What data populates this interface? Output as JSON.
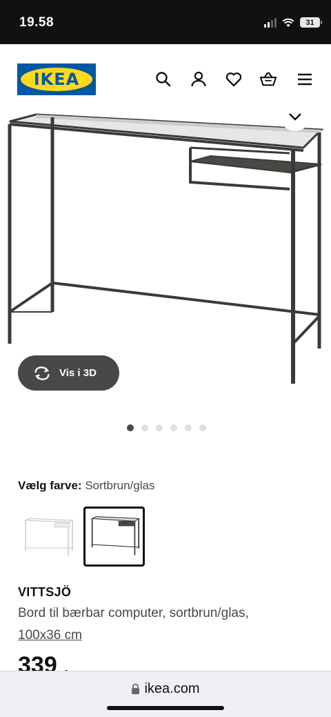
{
  "status_bar": {
    "time": "19.58",
    "battery": "31"
  },
  "header": {
    "logo_text": "IKEA",
    "icons": [
      "search-icon",
      "user-icon",
      "heart-icon",
      "basket-icon",
      "menu-icon"
    ]
  },
  "gallery": {
    "viewer_3d_label": "Vis i 3D",
    "image_count": 6,
    "active_index": 0
  },
  "color_picker": {
    "label": "Vælg farve:",
    "value": "Sortbrun/glas"
  },
  "product": {
    "name": "VITTSJÖ",
    "description": "Bord til bærbar computer, sortbrun/glas,",
    "size": "100x36 cm",
    "price": "339",
    "price_suffix": "-"
  },
  "browser": {
    "url": "ikea.com"
  },
  "colors": {
    "ikea_blue": "#0058a3",
    "ikea_yellow": "#ffda1a",
    "frame_dark": "#3a3a38",
    "button_dark": "#484848"
  }
}
